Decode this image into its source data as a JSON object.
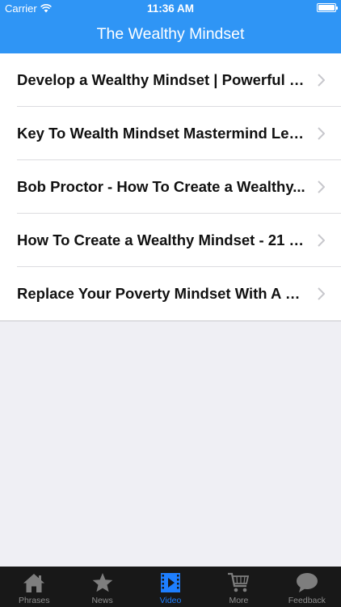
{
  "status_bar": {
    "carrier": "Carrier",
    "time": "11:36 AM"
  },
  "nav": {
    "title": "The Wealthy Mindset"
  },
  "videos": [
    {
      "title": "Develop a Wealthy Mindset | Powerful S..."
    },
    {
      "title": "Key To Wealth Mindset Mastermind Les..."
    },
    {
      "title": "Bob Proctor - How To Create a Wealthy..."
    },
    {
      "title": "How To Create a Wealthy Mindset - 21 Ti..."
    },
    {
      "title": "Replace Your Poverty Mindset With A W..."
    }
  ],
  "tabs": [
    {
      "label": "Phrases",
      "icon": "house-icon",
      "active": false
    },
    {
      "label": "News",
      "icon": "star-icon",
      "active": false
    },
    {
      "label": "Video",
      "icon": "film-icon",
      "active": true
    },
    {
      "label": "More",
      "icon": "cart-icon",
      "active": false
    },
    {
      "label": "Feedback",
      "icon": "speech-bubble-icon",
      "active": false
    }
  ],
  "colors": {
    "header_blue": "#2f95f5",
    "tab_active": "#1e7fff",
    "tab_inactive": "#8e8e8e",
    "tabbar_bg": "#181818"
  }
}
